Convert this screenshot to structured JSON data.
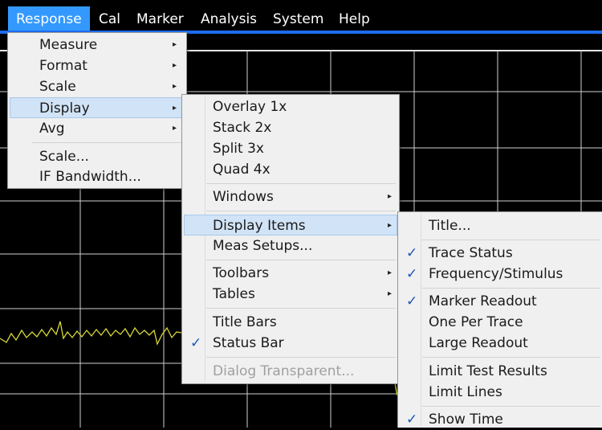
{
  "menubar": {
    "items": [
      {
        "label": "Response"
      },
      {
        "label": "Cal"
      },
      {
        "label": "Marker"
      },
      {
        "label": "Analysis"
      },
      {
        "label": "System"
      },
      {
        "label": "Help"
      }
    ]
  },
  "response_menu": {
    "items": [
      {
        "label": "Measure"
      },
      {
        "label": "Format"
      },
      {
        "label": "Scale"
      },
      {
        "label": "Display"
      },
      {
        "label": "Avg"
      },
      {
        "label": "Scale..."
      },
      {
        "label": "IF Bandwidth..."
      }
    ]
  },
  "display_menu": {
    "items": [
      {
        "label": "Overlay 1x"
      },
      {
        "label": "Stack 2x"
      },
      {
        "label": "Split 3x"
      },
      {
        "label": "Quad 4x"
      },
      {
        "label": "Windows"
      },
      {
        "label": "Display Items"
      },
      {
        "label": "Meas Setups..."
      },
      {
        "label": "Toolbars"
      },
      {
        "label": "Tables"
      },
      {
        "label": "Title Bars"
      },
      {
        "label": "Status Bar"
      },
      {
        "label": "Dialog Transparent..."
      }
    ]
  },
  "display_items_menu": {
    "items": [
      {
        "label": "Title..."
      },
      {
        "label": "Trace Status"
      },
      {
        "label": "Frequency/Stimulus"
      },
      {
        "label": "Marker Readout"
      },
      {
        "label": "One Per Trace"
      },
      {
        "label": "Large Readout"
      },
      {
        "label": "Limit Test Results"
      },
      {
        "label": "Limit Lines"
      },
      {
        "label": "Show Time"
      }
    ]
  },
  "glyphs": {
    "arrow": "▸",
    "check": "✓"
  },
  "colors": {
    "menu_highlight": "#d1e3f6",
    "menubar_active": "#3399ff",
    "trace": "#d8d835",
    "grid": "#d0d0d0"
  }
}
